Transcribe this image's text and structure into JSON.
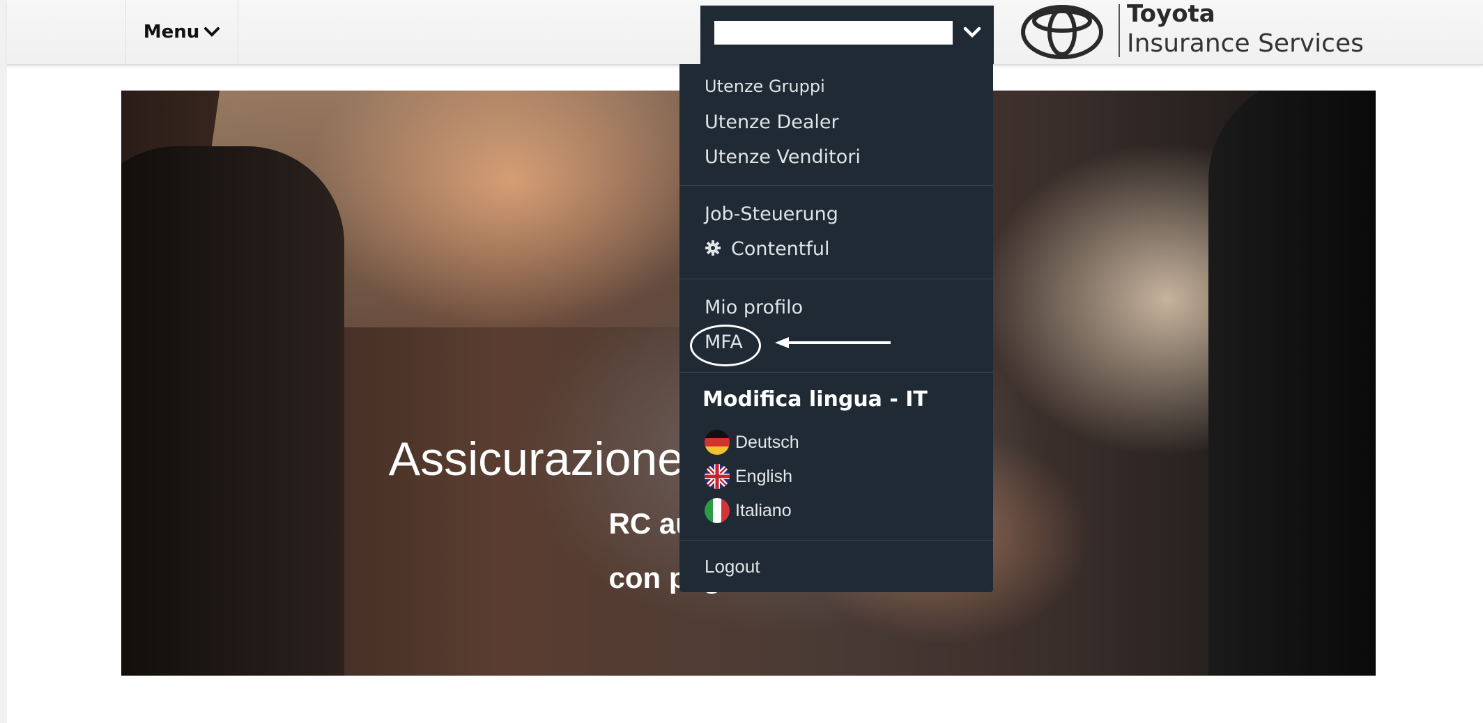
{
  "header": {
    "menu_label": "Menu",
    "logo": {
      "brand": "Toyota",
      "subtitle": "Insurance Services"
    }
  },
  "hero": {
    "title": "Assicurazione auto Toyota",
    "subtitle_line1": "RC auto",
    "subtitle_line2": "con pag"
  },
  "user_menu": {
    "groups": [
      {
        "items": [
          "Utenze Gruppi",
          "Utenze Dealer",
          "Utenze Venditori"
        ]
      },
      {
        "items": [
          "Job-Steuerung",
          "Contentful"
        ]
      },
      {
        "items": [
          "Mio profilo",
          "MFA"
        ]
      }
    ],
    "language_heading": "Modifica lingua - IT",
    "languages": [
      "Deutsch",
      "English",
      "Italiano"
    ],
    "logout": "Logout"
  },
  "colors": {
    "dropdown_bg": "#1f2a35",
    "header_bg": "#f4f4f4",
    "annotation": "#ffffff"
  },
  "icons": [
    "chevron-down-icon",
    "toyota-logo",
    "gear-icon",
    "flag-de-icon",
    "flag-gb-icon",
    "flag-it-icon"
  ]
}
